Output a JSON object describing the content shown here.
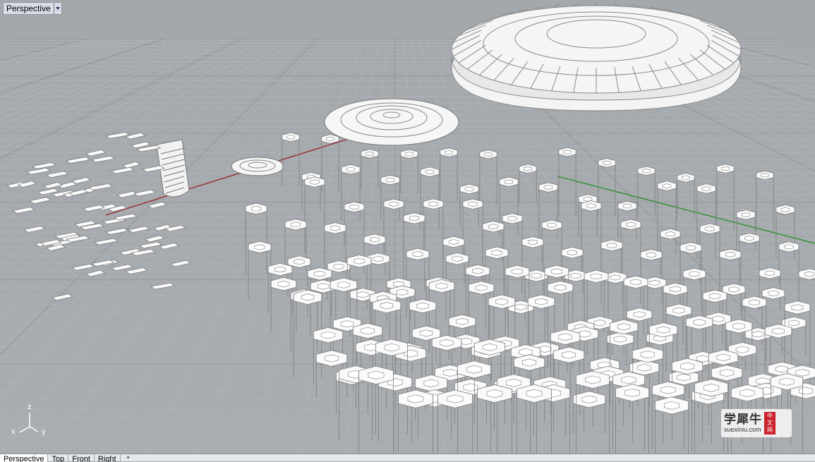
{
  "viewport": {
    "title": "Perspective"
  },
  "axes": {
    "x": "x",
    "y": "y",
    "z": "z"
  },
  "watermark": {
    "main": "学犀牛",
    "sub": "xuexiniu.com",
    "badge": [
      "中",
      "文",
      "网"
    ]
  },
  "tabs": [
    {
      "label": "Perspective",
      "active": true
    },
    {
      "label": "Top",
      "active": false
    },
    {
      "label": "Front",
      "active": false
    },
    {
      "label": "Right",
      "active": false
    }
  ],
  "tab_add_label": "+",
  "colors": {
    "background": "#a6aaae",
    "grid_minor": "#b4b8bc",
    "grid_major": "#8f9499",
    "x_axis": "#9b2a2a",
    "y_axis": "#2f8f2f",
    "model_fill": "#f2f2f2",
    "model_shade": "#d6d6d6",
    "model_edge": "#7e7e7e"
  }
}
